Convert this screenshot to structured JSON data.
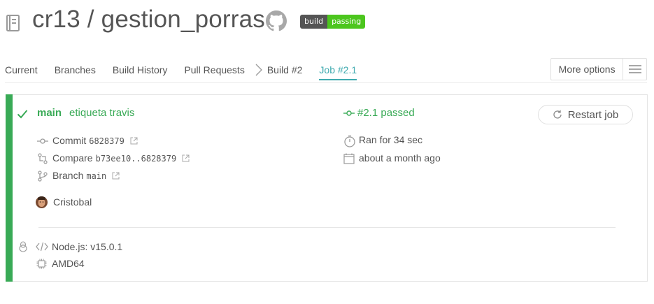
{
  "repo": {
    "title": "cr13 / gestion_porras",
    "badge_left": "build",
    "badge_right": "passing"
  },
  "tabs": {
    "items": [
      "Current",
      "Branches",
      "Build History",
      "Pull Requests",
      "Build #2",
      "Job #2.1"
    ],
    "active": "Job #2.1",
    "more_options": "More options"
  },
  "job": {
    "state": "passed",
    "branch": "main",
    "commit_message": "etiqueta travis",
    "commit_label": "Commit",
    "commit_sha": "6828379",
    "compare_label": "Compare",
    "compare_range": "b73ee10..6828379",
    "branch_label": "Branch",
    "branch_value": "main",
    "author": "Cristobal",
    "status_text": "#2.1 passed",
    "duration": "Ran for 34 sec",
    "finished": "about a month ago",
    "restart_label": "Restart job",
    "language": "Node.js: v15.0.1",
    "arch": "AMD64",
    "os_icon": "linux-icon"
  },
  "colors": {
    "passed": "#39aa56",
    "active_tab": "#3eaaaf",
    "badge_passing": "#4cc61e"
  }
}
